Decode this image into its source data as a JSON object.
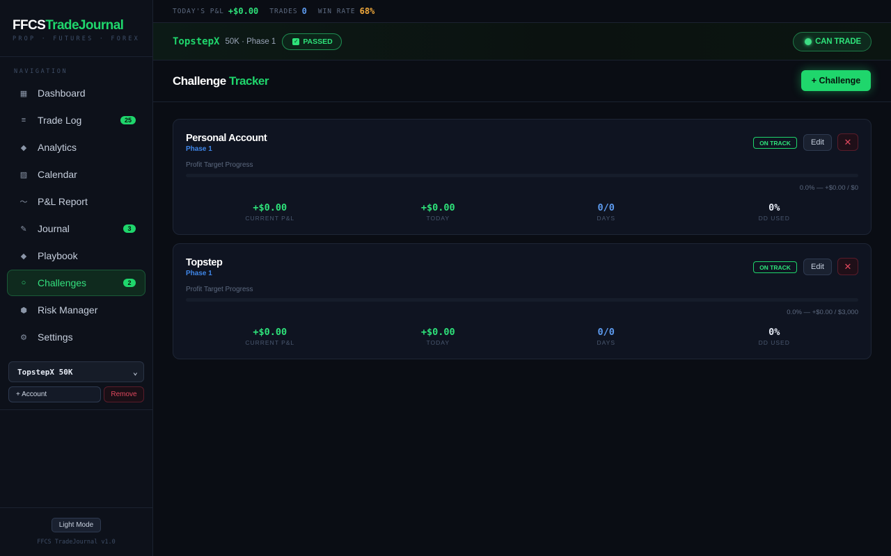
{
  "brand": {
    "name_part1": "FFCS",
    "name_part2": "TradeJournal",
    "tagline": "PROP · FUTURES · FOREX"
  },
  "colors": {
    "accent": "#1fd66c",
    "danger": "#e2485e",
    "info": "#3f86e8",
    "warning": "#f2a93b"
  },
  "sidebar": {
    "heading": "NAVIGATION",
    "items": [
      {
        "label": "Dashboard",
        "icon": "grid-icon",
        "glyph": "▦",
        "badge": ""
      },
      {
        "label": "Trade Log",
        "icon": "list-icon",
        "glyph": "≡",
        "badge": "25"
      },
      {
        "label": "Analytics",
        "icon": "diamond-icon",
        "glyph": "◆",
        "badge": ""
      },
      {
        "label": "Calendar",
        "icon": "calendar-icon",
        "glyph": "▨",
        "badge": ""
      },
      {
        "label": "P&L Report",
        "icon": "wave-icon",
        "glyph": "〜",
        "badge": ""
      },
      {
        "label": "Journal",
        "icon": "pencil-icon",
        "glyph": "✎",
        "badge": "3"
      },
      {
        "label": "Playbook",
        "icon": "book-icon",
        "glyph": "◆",
        "badge": ""
      },
      {
        "label": "Challenges",
        "icon": "target-icon",
        "glyph": "○",
        "badge": "2",
        "active": true
      },
      {
        "label": "Risk Manager",
        "icon": "shield-icon",
        "glyph": "⬢",
        "badge": ""
      },
      {
        "label": "Settings",
        "icon": "gear-icon",
        "glyph": "⚙",
        "badge": ""
      }
    ],
    "account_select": {
      "value": "TopstepX 50K"
    },
    "add_account_label": "+ Account",
    "remove_label": "Remove",
    "light_mode_label": "Light Mode",
    "version": "FFCS TradeJournal v1.0"
  },
  "topbar": {
    "pnl_label": "TODAY'S P&L",
    "pnl_value": "+$0.00",
    "trades_label": "TRADES",
    "trades_value": "0",
    "winrate_label": "WIN RATE",
    "winrate_value": "68%"
  },
  "banner": {
    "account": "TopstepX",
    "detail": "50K · Phase 1",
    "status": "PASSED",
    "trade_status": "CAN TRADE"
  },
  "header": {
    "title_part1": "Challenge",
    "title_part2": "Tracker",
    "add_button": "+ Challenge"
  },
  "challenges": [
    {
      "name": "Personal Account",
      "phase": "Phase 1",
      "status": "ON TRACK",
      "edit_label": "Edit",
      "delete_glyph": "✕",
      "progress_label": "Profit Target Progress",
      "progress_pct": 0,
      "progress_text": "0.0% — +$0.00 / $0",
      "metrics": [
        {
          "value": "+$0.00",
          "label": "CURRENT P&L",
          "color": "#2ee27a"
        },
        {
          "value": "+$0.00",
          "label": "TODAY",
          "color": "#2ee27a"
        },
        {
          "value": "0/0",
          "label": "DAYS",
          "color": "#5d9bef"
        },
        {
          "value": "0%",
          "label": "DD USED",
          "color": "#e6ebf5"
        }
      ]
    },
    {
      "name": "Topstep",
      "phase": "Phase 1",
      "status": "ON TRACK",
      "edit_label": "Edit",
      "delete_glyph": "✕",
      "progress_label": "Profit Target Progress",
      "progress_pct": 0,
      "progress_text": "0.0% — +$0.00 / $3,000",
      "metrics": [
        {
          "value": "+$0.00",
          "label": "CURRENT P&L",
          "color": "#2ee27a"
        },
        {
          "value": "+$0.00",
          "label": "TODAY",
          "color": "#2ee27a"
        },
        {
          "value": "0/0",
          "label": "DAYS",
          "color": "#5d9bef"
        },
        {
          "value": "0%",
          "label": "DD USED",
          "color": "#e6ebf5"
        }
      ]
    }
  ]
}
